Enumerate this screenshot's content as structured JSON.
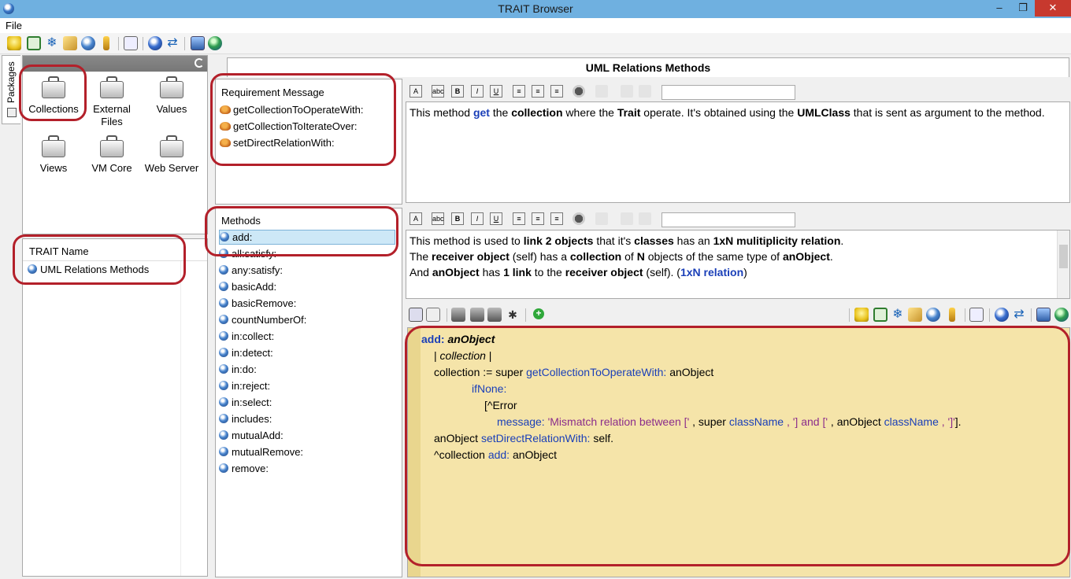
{
  "window": {
    "title": "TRAIT Browser",
    "minimize": "–",
    "maximize": "❐",
    "close": "✕"
  },
  "menu": {
    "file": "File"
  },
  "sidebar": {
    "tab_label": "Packages"
  },
  "packages": [
    {
      "label": "Collections"
    },
    {
      "label": "External\nFiles"
    },
    {
      "label": "Values"
    },
    {
      "label": "Views"
    },
    {
      "label": "VM Core"
    },
    {
      "label": "Web Server"
    }
  ],
  "trait_list": {
    "header": "TRAIT Name",
    "items": [
      "UML Relations Methods"
    ]
  },
  "main": {
    "title": "UML Relations Methods"
  },
  "requirements": {
    "header": "Requirement Message",
    "items": [
      "getCollectionToOperateWith:",
      "getCollectionToIterateOver:",
      "setDirectRelationWith:"
    ]
  },
  "methods": {
    "header": "Methods",
    "items": [
      "add:",
      "all:satisfy:",
      "any:satisfy:",
      "basicAdd:",
      "basicRemove:",
      "countNumberOf:",
      "in:collect:",
      "in:detect:",
      "in:do:",
      "in:reject:",
      "in:select:",
      "includes:",
      "mutualAdd:",
      "mutualRemove:",
      "remove:"
    ],
    "selected": "add:"
  },
  "requirement_doc": {
    "parts": [
      "This method ",
      "get",
      " the ",
      "collection",
      " where the ",
      "Trait",
      " operate. It's obtained using the ",
      "UMLClass",
      " that is sent as argument to the method."
    ]
  },
  "method_doc": {
    "line1": [
      "This method is used to ",
      "link 2 objects",
      " that it's ",
      "classes",
      " has an ",
      "1xN mulitiplicity relation",
      "."
    ],
    "line2": [
      "The ",
      "receiver object",
      " (self) has a ",
      "collection",
      " of ",
      "N",
      " objects of the same type of ",
      "anObject",
      "."
    ],
    "line3": [
      "And ",
      "anObject",
      " has ",
      "1 link",
      " to the ",
      "receiver object",
      " (self). (",
      "1xN relation",
      ")"
    ]
  },
  "formatbar": {
    "buttons": [
      "A",
      "abc",
      "B",
      "I",
      "U",
      "≡",
      "≡",
      "≡"
    ]
  },
  "code": {
    "l1": [
      "add: ",
      "anObject"
    ],
    "l2": [
      "| ",
      "collection",
      " |"
    ],
    "l3": [
      "collection := super ",
      "getCollectionToOperateWith:",
      " anObject"
    ],
    "l4": [
      "ifNone:"
    ],
    "l5": [
      "[^Error"
    ],
    "l6": [
      "message:",
      " 'Mismatch relation between [' ",
      ", super ",
      "className",
      " ",
      ", '] and [' ",
      ", anObject ",
      "className",
      " ",
      ", ']'",
      "]."
    ],
    "l7": [
      "anObject ",
      "setDirectRelationWith:",
      " self."
    ],
    "l8": [
      "^collection ",
      "add:",
      " anObject"
    ]
  },
  "colors": {
    "accent": "#b3202a",
    "code_bg": "#f5e4a9",
    "keyword": "#1a3fb8",
    "string": "#8b2c8b",
    "selection": "#cde8f7"
  }
}
